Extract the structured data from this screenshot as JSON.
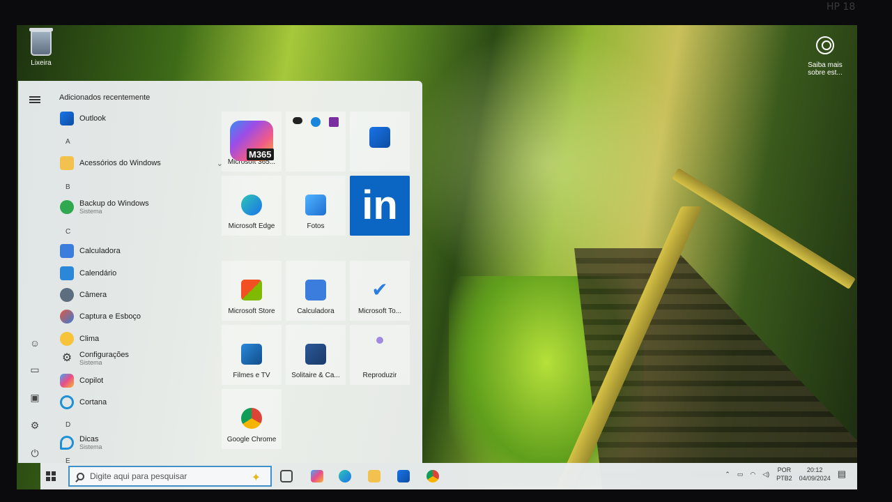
{
  "bezel_label": "HP 18",
  "desktop": {
    "recycle_bin_label": "Lixeira",
    "info_label_line1": "Saiba mais",
    "info_label_line2": "sobre est..."
  },
  "start_menu": {
    "header": "Adicionados recentemente",
    "apps": {
      "outlook": "Outlook",
      "letter_a": "A",
      "accessories": "Acessórios do Windows",
      "letter_b": "B",
      "backup": "Backup do Windows",
      "backup_sub": "Sistema",
      "letter_c": "C",
      "calculator": "Calculadora",
      "calendar": "Calendário",
      "camera": "Câmera",
      "snip": "Captura e Esboço",
      "weather": "Clima",
      "settings": "Configurações",
      "settings_sub": "Sistema",
      "copilot": "Copilot",
      "cortana": "Cortana",
      "letter_d": "D",
      "tips": "Dicas",
      "tips_sub": "Sistema",
      "letter_e": "E"
    },
    "tiles": {
      "m365": "Microsoft 365...",
      "m365_badge": "M365",
      "edge": "Microsoft Edge",
      "photos": "Fotos",
      "linkedin": "in",
      "store": "Microsoft Store",
      "calculator": "Calculadora",
      "todo": "Microsoft To...",
      "movies": "Filmes e TV",
      "solitaire": "Solitaire & Ca...",
      "play": "Reproduzir",
      "chrome": "Google Chrome"
    }
  },
  "taskbar": {
    "search_placeholder": "Digite aqui para pesquisar",
    "lang_line1": "POR",
    "lang_line2": "PTB2",
    "time": "20:12",
    "date": "04/09/2024"
  },
  "colors": {
    "accent": "#0a66c2",
    "search_border": "#3f8fc9"
  }
}
